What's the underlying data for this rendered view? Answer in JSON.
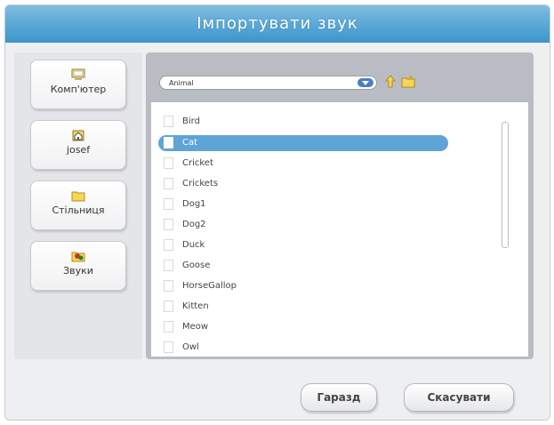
{
  "dialog": {
    "title": "Імпортувати звук"
  },
  "places": [
    {
      "label": "Комп'ютер",
      "icon": "computer-icon"
    },
    {
      "label": "josef",
      "icon": "home-icon"
    },
    {
      "label": "Стільниця",
      "icon": "folder-icon"
    },
    {
      "label": "Звуки",
      "icon": "sounds-icon"
    }
  ],
  "toolbar": {
    "folder_value": "Animal",
    "up_icon": "up-folder-icon",
    "new_folder_icon": "new-folder-icon"
  },
  "files": [
    {
      "name": "Bird",
      "selected": false
    },
    {
      "name": "Cat",
      "selected": true
    },
    {
      "name": "Cricket",
      "selected": false
    },
    {
      "name": "Crickets",
      "selected": false
    },
    {
      "name": "Dog1",
      "selected": false
    },
    {
      "name": "Dog2",
      "selected": false
    },
    {
      "name": "Duck",
      "selected": false
    },
    {
      "name": "Goose",
      "selected": false
    },
    {
      "name": "HorseGallop",
      "selected": false
    },
    {
      "name": "Kitten",
      "selected": false
    },
    {
      "name": "Meow",
      "selected": false
    },
    {
      "name": "Owl",
      "selected": false
    }
  ],
  "buttons": {
    "ok": "Гаразд",
    "cancel": "Скасувати"
  },
  "colors": {
    "title_bar": "#58a7d6",
    "selection": "#5ea4d6",
    "panel": "#b9bcc2"
  }
}
